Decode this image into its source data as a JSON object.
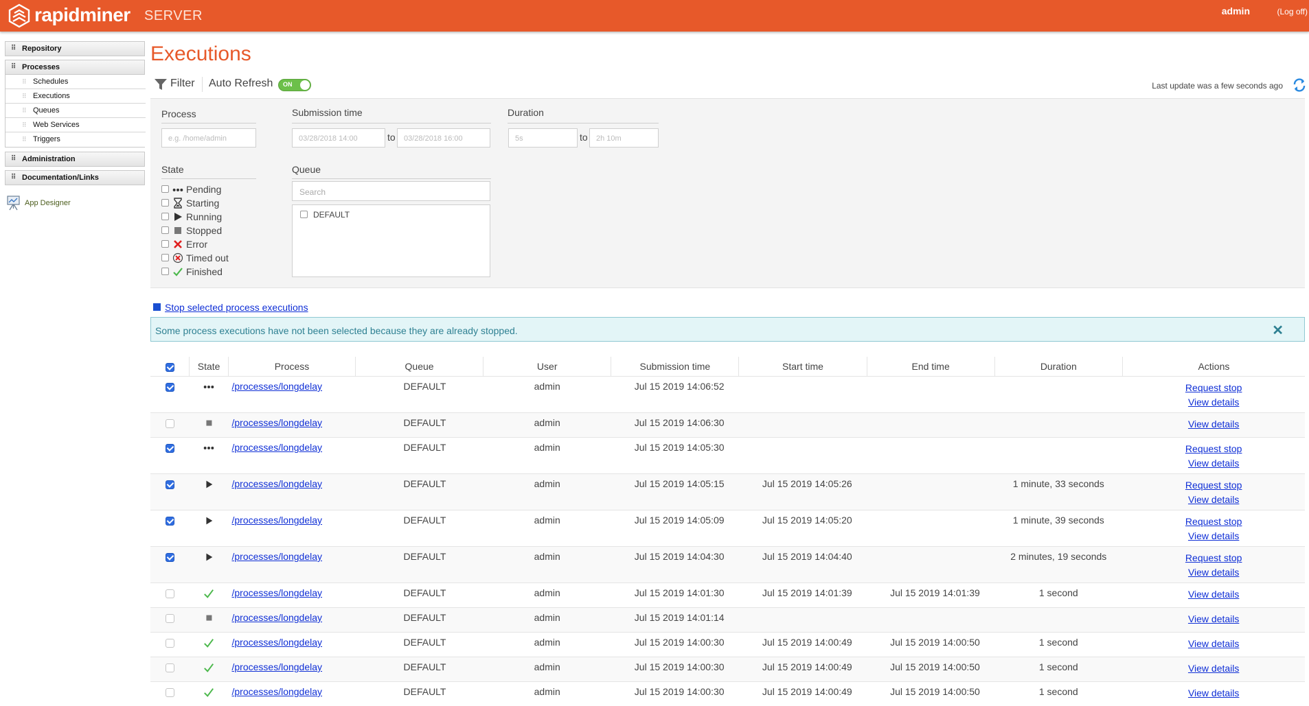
{
  "header": {
    "brand": "rapidminer",
    "product": "SERVER",
    "user": "admin",
    "logoff": "(Log off)",
    "background_color": "#e7592a"
  },
  "sidebar": {
    "repository": "Repository",
    "processes": "Processes",
    "process_items": [
      "Schedules",
      "Executions",
      "Queues",
      "Web Services",
      "Triggers"
    ],
    "administration": "Administration",
    "documentation": "Documentation/Links",
    "app_designer": "App Designer"
  },
  "page": {
    "title": "Executions",
    "filter": "Filter",
    "auto_refresh": "Auto Refresh",
    "auto_refresh_state": "ON",
    "last_update": "Last update was a few seconds ago"
  },
  "filters": {
    "process_label": "Process",
    "process_placeholder": "e.g. /home/admin",
    "submission_label": "Submission time",
    "submission_from": "03/28/2018 14:00",
    "submission_to": "03/28/2018 16:00",
    "to_word": "to",
    "duration_label": "Duration",
    "duration_from": "5s",
    "duration_to": "2h 10m",
    "state_label": "State",
    "states": [
      {
        "label": "Pending",
        "icon": "pending-icon"
      },
      {
        "label": "Starting",
        "icon": "hourglass-icon"
      },
      {
        "label": "Running",
        "icon": "play-icon"
      },
      {
        "label": "Stopped",
        "icon": "stop-icon"
      },
      {
        "label": "Error",
        "icon": "error-x-icon"
      },
      {
        "label": "Timed out",
        "icon": "timeout-icon"
      },
      {
        "label": "Finished",
        "icon": "checkmark-icon"
      }
    ],
    "queue_label": "Queue",
    "queue_search_placeholder": "Search",
    "queues": [
      "DEFAULT"
    ]
  },
  "actions": {
    "stop_selected": "Stop selected process executions"
  },
  "alert": {
    "message": "Some process executions have not been selected because they are already stopped.",
    "close": "✕"
  },
  "table": {
    "headers": [
      "State",
      "Process",
      "Queue",
      "User",
      "Submission time",
      "Start time",
      "End time",
      "Duration",
      "Actions"
    ],
    "header_checked": true,
    "rows": [
      {
        "checked": true,
        "state": "pending",
        "process": "/processes/longdelay",
        "queue": "DEFAULT",
        "user": "admin",
        "submission": "Jul 15 2019 14:06:52",
        "start": "",
        "end": "",
        "duration": "",
        "actions": [
          "Request stop",
          "View details"
        ]
      },
      {
        "checked": false,
        "state": "stopped",
        "process": "/processes/longdelay",
        "queue": "DEFAULT",
        "user": "admin",
        "submission": "Jul 15 2019 14:06:30",
        "start": "",
        "end": "",
        "duration": "",
        "actions": [
          "View details"
        ]
      },
      {
        "checked": true,
        "state": "pending",
        "process": "/processes/longdelay",
        "queue": "DEFAULT",
        "user": "admin",
        "submission": "Jul 15 2019 14:05:30",
        "start": "",
        "end": "",
        "duration": "",
        "actions": [
          "Request stop",
          "View details"
        ]
      },
      {
        "checked": true,
        "state": "running",
        "process": "/processes/longdelay",
        "queue": "DEFAULT",
        "user": "admin",
        "submission": "Jul 15 2019 14:05:15",
        "start": "Jul 15 2019 14:05:26",
        "end": "",
        "duration": "1 minute, 33 seconds",
        "actions": [
          "Request stop",
          "View details"
        ]
      },
      {
        "checked": true,
        "state": "running",
        "process": "/processes/longdelay",
        "queue": "DEFAULT",
        "user": "admin",
        "submission": "Jul 15 2019 14:05:09",
        "start": "Jul 15 2019 14:05:20",
        "end": "",
        "duration": "1 minute, 39 seconds",
        "actions": [
          "Request stop",
          "View details"
        ]
      },
      {
        "checked": true,
        "state": "running",
        "process": "/processes/longdelay",
        "queue": "DEFAULT",
        "user": "admin",
        "submission": "Jul 15 2019 14:04:30",
        "start": "Jul 15 2019 14:04:40",
        "end": "",
        "duration": "2 minutes, 19 seconds",
        "actions": [
          "Request stop",
          "View details"
        ]
      },
      {
        "checked": false,
        "state": "finished",
        "process": "/processes/longdelay",
        "queue": "DEFAULT",
        "user": "admin",
        "submission": "Jul 15 2019 14:01:30",
        "start": "Jul 15 2019 14:01:39",
        "end": "Jul 15 2019 14:01:39",
        "duration": "1 second",
        "actions": [
          "View details"
        ]
      },
      {
        "checked": false,
        "state": "stopped",
        "process": "/processes/longdelay",
        "queue": "DEFAULT",
        "user": "admin",
        "submission": "Jul 15 2019 14:01:14",
        "start": "",
        "end": "",
        "duration": "",
        "actions": [
          "View details"
        ]
      },
      {
        "checked": false,
        "state": "finished",
        "process": "/processes/longdelay",
        "queue": "DEFAULT",
        "user": "admin",
        "submission": "Jul 15 2019 14:00:30",
        "start": "Jul 15 2019 14:00:49",
        "end": "Jul 15 2019 14:00:50",
        "duration": "1 second",
        "actions": [
          "View details"
        ]
      },
      {
        "checked": false,
        "state": "finished",
        "process": "/processes/longdelay",
        "queue": "DEFAULT",
        "user": "admin",
        "submission": "Jul 15 2019 14:00:30",
        "start": "Jul 15 2019 14:00:49",
        "end": "Jul 15 2019 14:00:50",
        "duration": "1 second",
        "actions": [
          "View details"
        ]
      },
      {
        "checked": false,
        "state": "finished",
        "process": "/processes/longdelay",
        "queue": "DEFAULT",
        "user": "admin",
        "submission": "Jul 15 2019 14:00:30",
        "start": "Jul 15 2019 14:00:49",
        "end": "Jul 15 2019 14:00:50",
        "duration": "1 second",
        "actions": [
          "View details"
        ]
      }
    ]
  }
}
